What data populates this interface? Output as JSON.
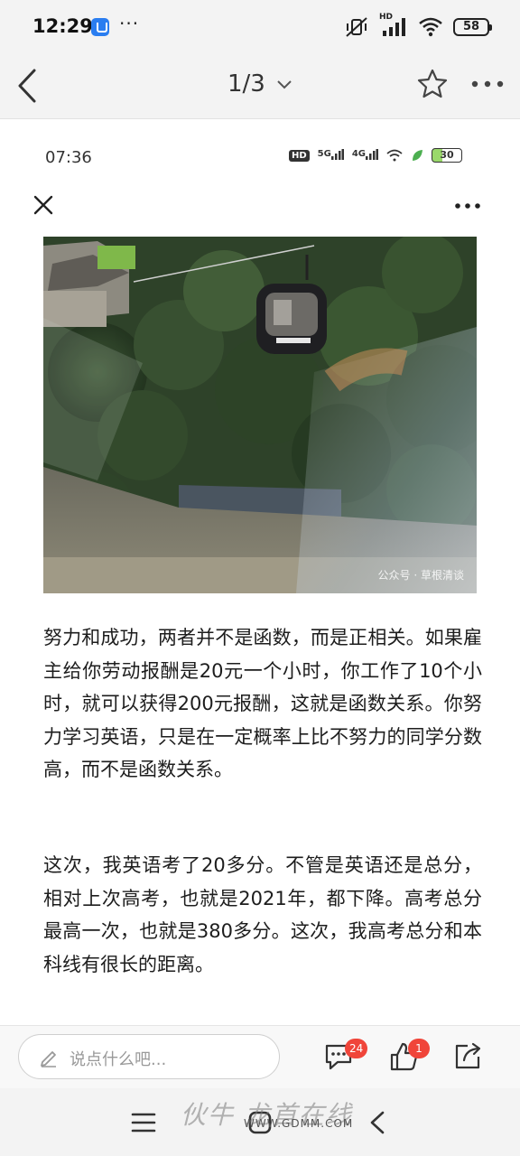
{
  "status_bar": {
    "time": "12:29",
    "overflow": "···",
    "hd_label": "HD",
    "battery": "58"
  },
  "nav": {
    "page_indicator": "1/3"
  },
  "embedded": {
    "time": "07:36",
    "hd": "HD",
    "net_5g": "5G",
    "net_4g": "4G",
    "battery": "30"
  },
  "photo": {
    "watermark": "公众号 · 草根清谈"
  },
  "article": {
    "paragraphs": [
      "努力和成功，两者并不是函数，而是正相关。如果雇主给你劳动报酬是20元一个小时，你工作了10个小时，就可以获得200元报酬，这就是函数关系。你努力学习英语，只是在一定概率上比不努力的同学分数高，而不是函数关系。",
      "这次，我英语考了20多分。不管是英语还是总分，相对上次高考，也就是2021年，都下降。高考总分最高一次，也就是380多分。这次，我高考总分和本科线有很长的距离。"
    ]
  },
  "actions": {
    "comment_placeholder": "说点什么吧...",
    "comment_count": "24",
    "like_count": "1"
  },
  "watermark_site": {
    "logo": "伙牛 龙首在线",
    "url": "WWW.GDMM.COM"
  },
  "colors": {
    "badge": "#f0453a",
    "bar_bg": "#f3f3f3"
  }
}
